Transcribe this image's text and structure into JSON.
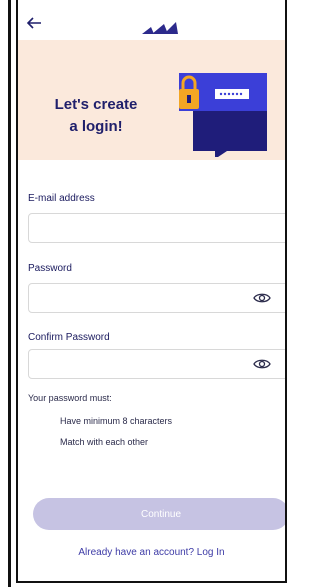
{
  "header": {
    "back_icon": "arrow-left-icon",
    "logo_icon": "brand-logo-icon"
  },
  "hero": {
    "title_line1": "Let's create",
    "title_line2": "a login!",
    "illustration": "lock-password-card-icon",
    "background_color": "#fbe9dc",
    "title_color": "#1f1f6b"
  },
  "form": {
    "email": {
      "label": "E-mail address",
      "value": "",
      "placeholder": ""
    },
    "password": {
      "label": "Password",
      "value": "",
      "placeholder": ""
    },
    "confirm_password": {
      "label": "Confirm Password",
      "value": "",
      "placeholder": ""
    },
    "eye_icon": "eye-icon"
  },
  "rules": {
    "title": "Your password must:",
    "items": [
      "Have minimum 8 characters",
      "Match with each other"
    ]
  },
  "actions": {
    "continue_label": "Continue",
    "continue_color": "#c6c3e3",
    "login_link": "Already have an account? Log In",
    "link_color": "#3d3ba6"
  }
}
